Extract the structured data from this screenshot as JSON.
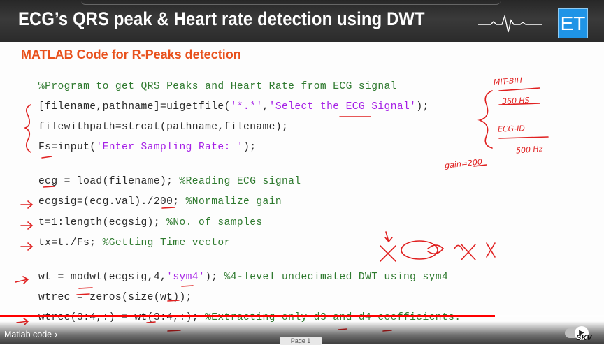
{
  "banner": {
    "title": "ECG’s QRS peak & Heart rate detection using DWT",
    "logo": "ET",
    "logo_color": "#1f94e6",
    "pulse_icon": "ekg-pulse-icon"
  },
  "slide": {
    "heading": "MATLAB Code for R-Peaks detection",
    "heading_color": "#e8511c",
    "code": {
      "l1": "%Program to get QRS Peaks and Heart Rate from ECG signal",
      "l2a": "[filename,pathname]=uigetfile(",
      "l2b": "'*.*'",
      "l2c": ",",
      "l2d": "'Select the ECG Signal'",
      "l2e": ");",
      "l3": "filewithpath=strcat(pathname,filename);",
      "l4a": "Fs=input(",
      "l4b": "'Enter Sampling Rate: '",
      "l4c": ");",
      "l5a": "ecg = load(filename); ",
      "l5b": "%Reading ECG signal",
      "l6a": "ecgsig=(ecg.val)./200; ",
      "l6b": "%Normalize gain",
      "l7a": "t=1:length(ecgsig); ",
      "l7b": "%No. of samples",
      "l8a": "tx=t./Fs; ",
      "l8b": "%Getting Time vector",
      "l9a": "wt = modwt(ecgsig,4,",
      "l9b": "'sym4'",
      "l9c": "); ",
      "l9d": "%4-level undecimated DWT using sym4",
      "l10": "wtrec = zeros(size(wt));",
      "l11a": "wtrec(3:4,:) = wt(3:4,:); ",
      "l11b": "%Extracting only d3 and d4 coefficients."
    },
    "annotations": {
      "a1": "MIT-BIH",
      "a2": "360 HS",
      "a3": "ECG-ID",
      "a4": "500 Hz",
      "a5": "gain=200"
    },
    "page_label": "Page 1"
  },
  "player": {
    "progress_fraction": 0.82,
    "progress_color": "#ff0000",
    "chapter": "Matlab code",
    "chevron": "›",
    "watermark": "SKV"
  }
}
